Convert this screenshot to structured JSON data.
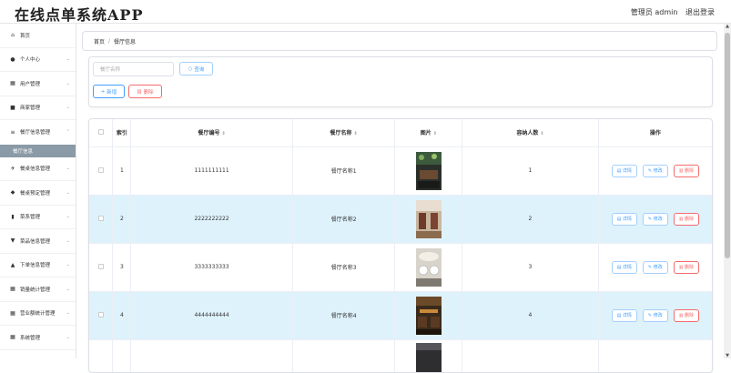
{
  "header": {
    "app_title": "在线点单系统APP",
    "user_label": "管理员 admin",
    "logout_label": "退出登录"
  },
  "sidebar": {
    "items": [
      {
        "icon": "home-icon",
        "glyph": "⌂",
        "label": "首页",
        "has_chevron": false
      },
      {
        "icon": "user-icon",
        "glyph": "●",
        "label": "个人中心",
        "has_chevron": true
      },
      {
        "icon": "grid-icon",
        "glyph": "▦",
        "label": "用户管理",
        "has_chevron": true
      },
      {
        "icon": "store-icon",
        "glyph": "■",
        "label": "商家管理",
        "has_chevron": true
      },
      {
        "icon": "list-icon",
        "glyph": "≡",
        "label": "餐厅信息管理",
        "has_chevron": true,
        "expanded": true,
        "sub": "餐厅信息"
      },
      {
        "icon": "flight-icon",
        "glyph": "✈",
        "label": "餐桌信息管理",
        "has_chevron": true
      },
      {
        "icon": "thumb-icon",
        "glyph": "◆",
        "label": "餐桌预定管理",
        "has_chevron": true
      },
      {
        "icon": "bar-chart-icon",
        "glyph": "▮",
        "label": "菜系管理",
        "has_chevron": true
      },
      {
        "icon": "tag-icon",
        "glyph": "▼",
        "label": "菜品信息管理",
        "has_chevron": true
      },
      {
        "icon": "bag-icon",
        "glyph": "▲",
        "label": "下单信息管理",
        "has_chevron": true
      },
      {
        "icon": "grid-icon",
        "glyph": "▦",
        "label": "销量统计管理",
        "has_chevron": true
      },
      {
        "icon": "grid-icon",
        "glyph": "▦",
        "label": "营业额统计管理",
        "has_chevron": true
      },
      {
        "icon": "grid-icon",
        "glyph": "▦",
        "label": "系统管理",
        "has_chevron": true
      }
    ]
  },
  "breadcrumb": {
    "home": "首页",
    "separator": "/",
    "current": "餐厅信息"
  },
  "search": {
    "placeholder": "餐厅名称",
    "search_label": "查询",
    "add_label": "新增",
    "delete_label": "删除"
  },
  "table": {
    "headers": {
      "index": "索引",
      "code": "餐厅编号",
      "name": "餐厅名称",
      "image": "图片",
      "capacity": "容纳人数",
      "actions": "操作"
    },
    "rows": [
      {
        "index": "1",
        "code": "1111111111",
        "name": "餐厅名称1",
        "capacity": "1"
      },
      {
        "index": "2",
        "code": "2222222222",
        "name": "餐厅名称2",
        "capacity": "2"
      },
      {
        "index": "3",
        "code": "3333333333",
        "name": "餐厅名称3",
        "capacity": "3"
      },
      {
        "index": "4",
        "code": "4444444444",
        "name": "餐厅名称4",
        "capacity": "4"
      }
    ],
    "actions": {
      "detail": "详情",
      "edit": "修改",
      "delete": "删除"
    }
  },
  "colors": {
    "primary": "#409eff",
    "danger": "#f56c6c",
    "stripe": "#def2fc",
    "sidebar_active": "#8a9aa6"
  }
}
